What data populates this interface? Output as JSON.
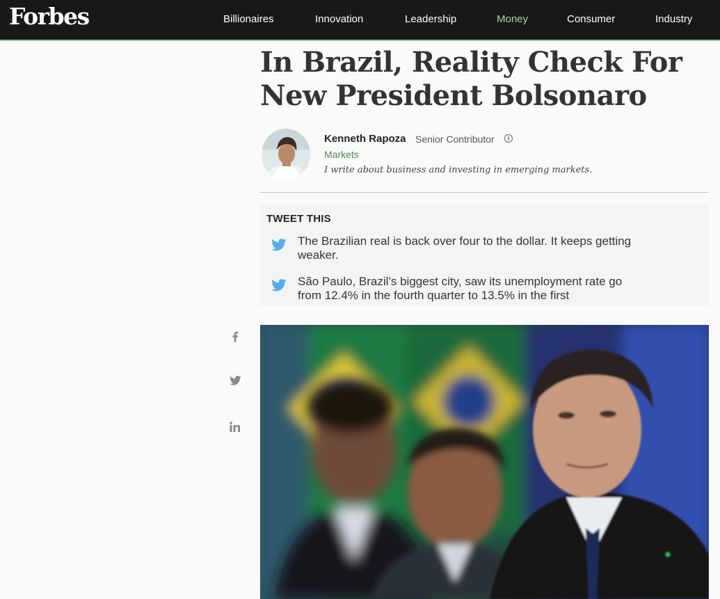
{
  "header": {
    "logo": "Forbes",
    "nav": [
      {
        "label": "Billionaires"
      },
      {
        "label": "Innovation"
      },
      {
        "label": "Leadership"
      },
      {
        "label": "Money",
        "active": true
      },
      {
        "label": "Consumer"
      },
      {
        "label": "Industry"
      }
    ]
  },
  "article": {
    "headline_line1": "In Brazil, Reality Check For",
    "headline_line2": "New President Bolsonaro",
    "author": {
      "name": "Kenneth Rapoza",
      "role": "Senior Contributor",
      "section": "Markets",
      "bio": "I write about business and investing in emerging markets."
    },
    "tweet_this": {
      "title": "TWEET THIS",
      "items": [
        {
          "line1": "The Brazilian real is back over four to the dollar. It keeps getting",
          "line2": "weaker."
        },
        {
          "line1": "São Paulo, Brazil’s biggest city, saw its unemployment rate go",
          "line2": "from 12.4% in the fourth quarter to 13.5% in the first"
        }
      ]
    },
    "share": [
      "facebook-icon",
      "twitter-icon",
      "linkedin-icon"
    ]
  },
  "colors": {
    "topbar": "#181818",
    "accent_green": "#a8d5a8",
    "twitter_blue": "#55acee",
    "section_green": "#4e8a4e"
  }
}
